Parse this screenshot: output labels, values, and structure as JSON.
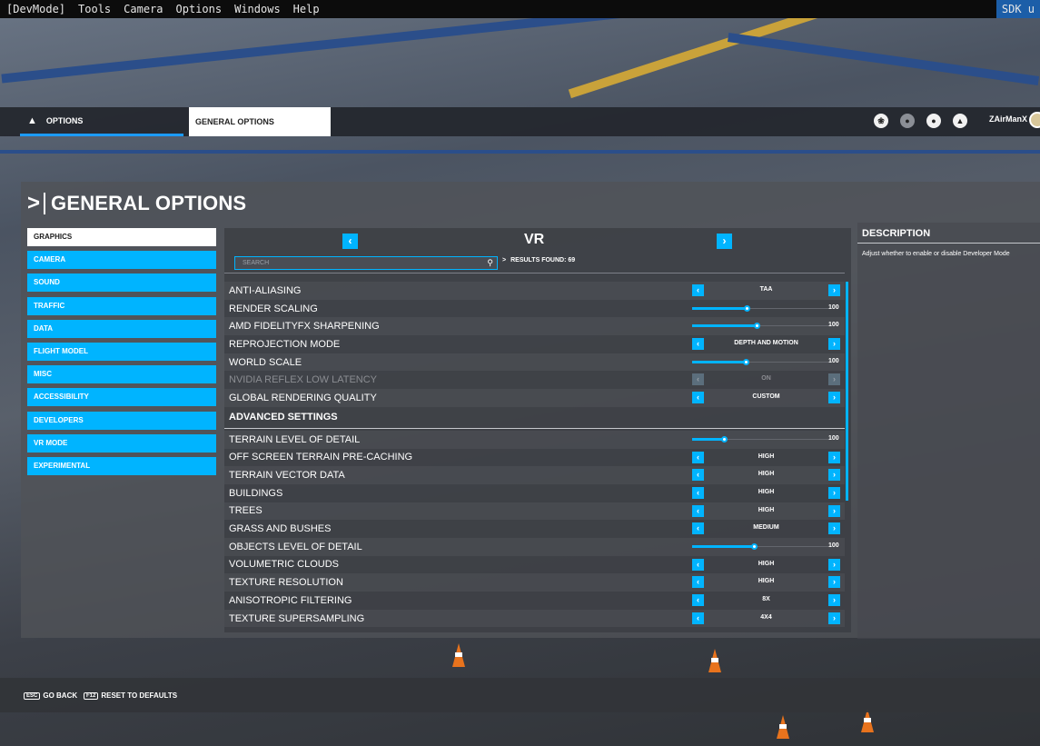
{
  "devbar": {
    "items": [
      "[DevMode]",
      "Tools",
      "Camera",
      "Options",
      "Windows",
      "Help"
    ],
    "sdk": "SDK u"
  },
  "nav": {
    "options_tab": "OPTIONS",
    "general_tab": "GENERAL OPTIONS",
    "username": "ZAirManX"
  },
  "page_title": "GENERAL OPTIONS",
  "categories": [
    "GRAPHICS",
    "CAMERA",
    "SOUND",
    "TRAFFIC",
    "DATA",
    "FLIGHT MODEL",
    "MISC",
    "ACCESSIBILITY",
    "DEVELOPERS",
    "VR MODE",
    "EXPERIMENTAL"
  ],
  "list": {
    "header": "VR",
    "search_placeholder": "SEARCH",
    "results": "RESULTS FOUND: 69",
    "rows": [
      {
        "label": "ANTI-ALIASING",
        "type": "select",
        "value": "TAA"
      },
      {
        "label": "RENDER SCALING",
        "type": "slider",
        "value": "100",
        "level": 0.4
      },
      {
        "label": "AMD FIDELITYFX SHARPENING",
        "type": "slider",
        "value": "100",
        "level": 0.47
      },
      {
        "label": "REPROJECTION MODE",
        "type": "select",
        "value": "DEPTH AND MOTION"
      },
      {
        "label": "WORLD SCALE",
        "type": "slider",
        "value": "100",
        "level": 0.39
      },
      {
        "label": "NVIDIA REFLEX LOW LATENCY",
        "type": "select",
        "value": "ON",
        "disabled": true
      },
      {
        "label": "GLOBAL RENDERING QUALITY",
        "type": "select",
        "value": "CUSTOM"
      },
      {
        "label": "ADVANCED SETTINGS",
        "type": "section"
      },
      {
        "label": "TERRAIN LEVEL OF DETAIL",
        "type": "slider",
        "value": "100",
        "level": 0.23
      },
      {
        "label": "OFF SCREEN TERRAIN PRE-CACHING",
        "type": "select",
        "value": "HIGH"
      },
      {
        "label": "TERRAIN VECTOR DATA",
        "type": "select",
        "value": "HIGH"
      },
      {
        "label": "BUILDINGS",
        "type": "select",
        "value": "HIGH"
      },
      {
        "label": "TREES",
        "type": "select",
        "value": "HIGH"
      },
      {
        "label": "GRASS AND BUSHES",
        "type": "select",
        "value": "MEDIUM"
      },
      {
        "label": "OBJECTS LEVEL OF DETAIL",
        "type": "slider",
        "value": "100",
        "level": 0.45
      },
      {
        "label": "VOLUMETRIC CLOUDS",
        "type": "select",
        "value": "HIGH"
      },
      {
        "label": "TEXTURE RESOLUTION",
        "type": "select",
        "value": "HIGH"
      },
      {
        "label": "ANISOTROPIC FILTERING",
        "type": "select",
        "value": "8X"
      },
      {
        "label": "TEXTURE SUPERSAMPLING",
        "type": "select",
        "value": "4X4"
      }
    ]
  },
  "description": {
    "title": "DESCRIPTION",
    "text": "Adjust whether to enable or disable Developer Mode"
  },
  "bottom": {
    "back_key": "ESC",
    "back": "GO BACK",
    "reset_key": "F12",
    "reset": "RESET TO DEFAULTS"
  }
}
